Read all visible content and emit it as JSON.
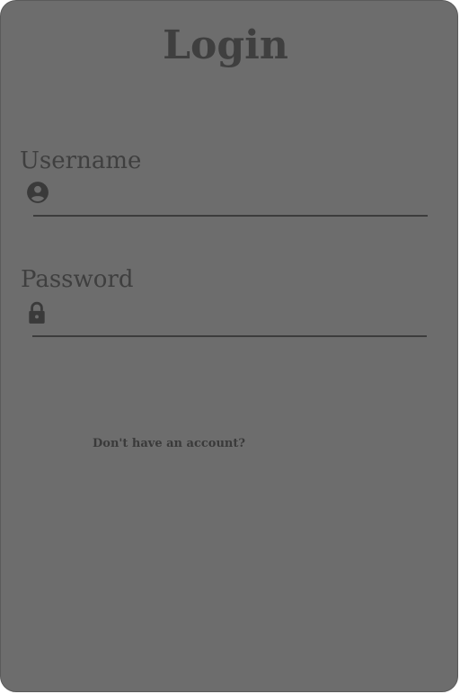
{
  "login": {
    "title": "Login",
    "username": {
      "label": "Username",
      "value": "",
      "placeholder": "",
      "icon": "user-circle-icon"
    },
    "password": {
      "label": "Password",
      "value": "",
      "placeholder": "",
      "icon": "lock-icon"
    },
    "account_link": "Don't have an account?",
    "colors": {
      "card_background": "#6d6d6d",
      "text": "#3f3f3f",
      "underline": "#3c3c3c"
    }
  }
}
